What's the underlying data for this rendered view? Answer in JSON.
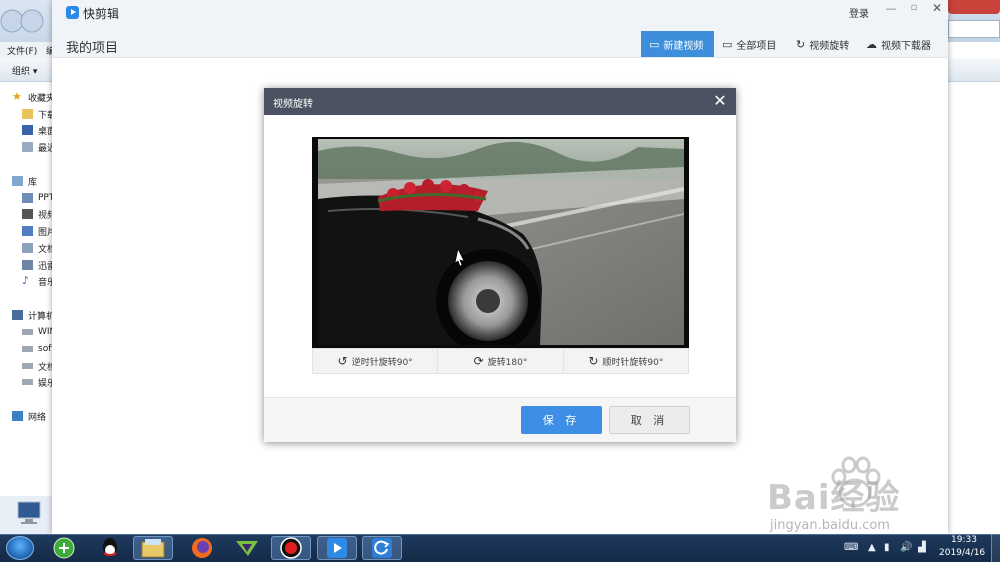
{
  "background_explorer": {
    "menu_file": "文件(F)",
    "menu_edit": "编",
    "organize": "组织 ▾",
    "nav": [
      {
        "label": "收藏夹",
        "icon": "star-icon"
      },
      {
        "label": "下载",
        "icon": "folder-icon"
      },
      {
        "label": "桌面",
        "icon": "desktop-icon"
      },
      {
        "label": "最近",
        "icon": "recent-icon"
      },
      {
        "label": "库",
        "icon": "library-icon"
      },
      {
        "label": "PPT",
        "icon": "folder-icon"
      },
      {
        "label": "视频",
        "icon": "video-folder-icon"
      },
      {
        "label": "图片",
        "icon": "picture-folder-icon"
      },
      {
        "label": "文档",
        "icon": "document-folder-icon"
      },
      {
        "label": "迅雷",
        "icon": "download-folder-icon"
      },
      {
        "label": "音乐",
        "icon": "music-icon"
      },
      {
        "label": "计算机",
        "icon": "computer-icon"
      },
      {
        "label": "WIN",
        "icon": "drive-icon"
      },
      {
        "label": "soft",
        "icon": "drive-icon"
      },
      {
        "label": "文档",
        "icon": "drive-icon"
      },
      {
        "label": "娱乐",
        "icon": "drive-icon"
      },
      {
        "label": "网络",
        "icon": "network-icon"
      }
    ]
  },
  "app": {
    "name": "快剪辑",
    "login": "登录",
    "page_title": "我的项目",
    "tabs": [
      {
        "label": "新建视频",
        "icon": "video-camera-icon",
        "active": true
      },
      {
        "label": "全部项目",
        "icon": "folder-icon",
        "active": false
      },
      {
        "label": "视频旋转",
        "icon": "rotate-icon",
        "active": false
      },
      {
        "label": "视频下载器",
        "icon": "cloud-download-icon",
        "active": false
      }
    ]
  },
  "dialog": {
    "title": "视频旋转",
    "rotate_ccw_label": "逆时针旋转90°",
    "rotate_180_label": "旋转180°",
    "rotate_cw_label": "顺时针旋转90°",
    "save_label": "保 存",
    "cancel_label": "取 消"
  },
  "taskbar": {
    "time": "19:33",
    "date": "2019/4/16",
    "apps": [
      "browser-360-icon",
      "qq-icon",
      "file-explorer-icon",
      "firefox-icon",
      "media-player-icon",
      "record-icon",
      "kuaijianji-icon",
      "refresh-app-icon"
    ]
  },
  "watermark": {
    "text": "Bai经验",
    "url": "jingyan.baidu.com"
  },
  "colors": {
    "accent": "#3d8fdb",
    "dialog_header": "#4b5261",
    "save_button": "#3e8ee6"
  }
}
